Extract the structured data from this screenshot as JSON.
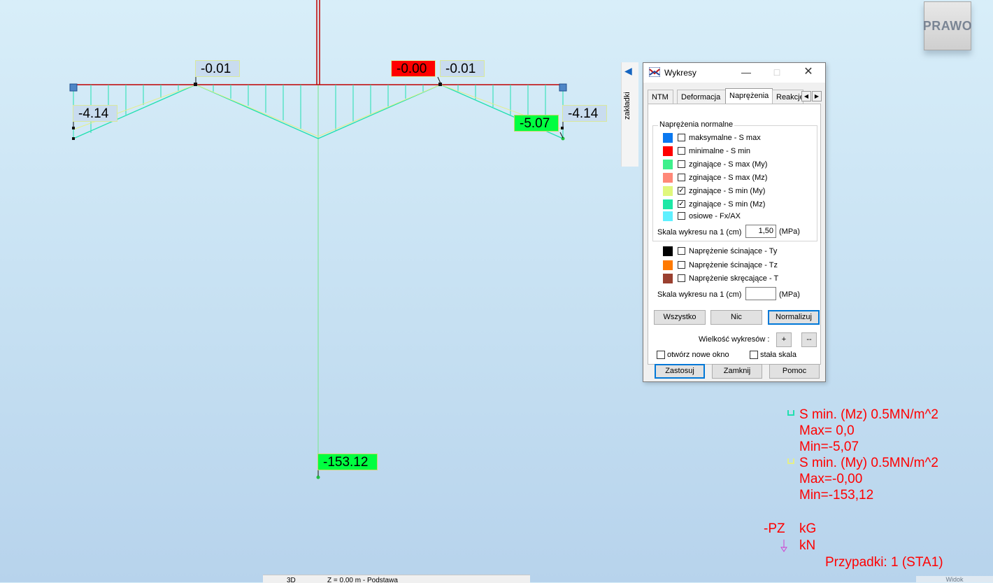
{
  "view": {
    "view_button": "PRAWO",
    "labels": {
      "top_left": "-0.01",
      "top_right_min": "-0.00",
      "top_right": "-0.01",
      "left_end": "-4.14",
      "right_min": "-5.07",
      "right_end": "-4.14",
      "column_bottom": "-153.12"
    },
    "colors": {
      "beam": "#c00000",
      "diagram_mz": "#20e0b0",
      "diagram_my": "#e4ef8a",
      "label_min": "#00ff40",
      "label_zero": "#ff0000",
      "label_default": "#c9dcef",
      "node": "#4f86c6"
    }
  },
  "sidebar_tab": {
    "label": "zakładki"
  },
  "dialog": {
    "title": "Wykresy",
    "tabs": [
      "NTM",
      "Deformacja",
      "Naprężenia",
      "Reakcje"
    ],
    "active_tab": "Naprężenia",
    "group_normal": {
      "title": "Naprężenia normalne",
      "items": [
        {
          "label": "maksymalne - S max",
          "color": "#0a78f0",
          "checked": false
        },
        {
          "label": "minimalne - S min",
          "color": "#ff0000",
          "checked": false
        },
        {
          "label": "zginające - S max (My)",
          "color": "#3ef08c",
          "checked": false
        },
        {
          "label": "zginające - S max (Mz)",
          "color": "#ff8878",
          "checked": false
        },
        {
          "label": "zginające - S min (My)",
          "color": "#e0f77c",
          "checked": true
        },
        {
          "label": "zginające - S min (Mz)",
          "color": "#1ee8a6",
          "checked": true
        },
        {
          "label": "osiowe - Fx/AX",
          "color": "#5ef0ff",
          "checked": false
        }
      ],
      "scale_label": "Skala wykresu na 1 (cm)",
      "scale_value": "1,50",
      "scale_unit": "(MPa)"
    },
    "group_shear": {
      "items": [
        {
          "label": "Naprężenie ścinające - Ty",
          "color": "#000000",
          "checked": false
        },
        {
          "label": "Naprężenie ścinające - Tz",
          "color": "#ff7a00",
          "checked": false
        },
        {
          "label": "Naprężenie skręcające - T",
          "color": "#9a4030",
          "checked": false
        }
      ],
      "scale_label": "Skala wykresu na 1 (cm)",
      "scale_value": "",
      "scale_unit": "(MPa)"
    },
    "buttons": {
      "all": "Wszystko",
      "none": "Nic",
      "normalize": "Normalizuj"
    },
    "size_label": "Wielkość wykresów :",
    "size_plus": "+",
    "size_minus": "--",
    "open_new_window": "otwórz nowe okno",
    "fixed_scale": "stała  skala",
    "apply": "Zastosuj",
    "close": "Zamknij",
    "help": "Pomoc"
  },
  "legend": {
    "mz_title": "S min. (Mz) 0.5MN/m^2",
    "mz_max": "Max=    0,0",
    "mz_min": "Min=-5,07",
    "my_title": "S min. (My) 0.5MN/m^2",
    "my_max": "Max=-0,00",
    "my_min": "Min=-153,12",
    "pz": "-PZ",
    "unit1": "kG",
    "unit2": "kN",
    "cases": "Przypadki: 1 (STA1)"
  },
  "statusbar": {
    "mode": "3D",
    "level": "Z = 0.00 m - Podstawa"
  },
  "corner": "Widok"
}
